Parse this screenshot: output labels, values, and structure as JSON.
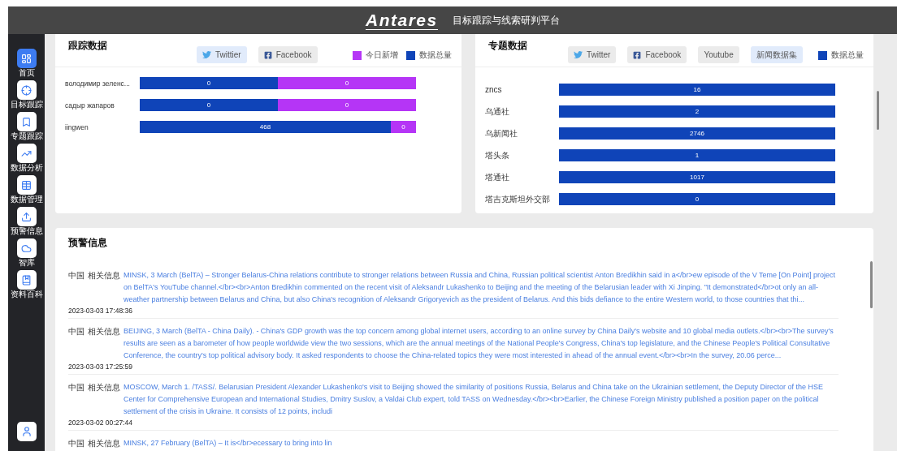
{
  "header": {
    "logo": "Antares",
    "title": "目标跟踪与线索研判平台"
  },
  "sidebar": {
    "items": [
      {
        "label": "首页",
        "selected": true
      },
      {
        "label": "目标跟踪",
        "selected": false
      },
      {
        "label": "专题跟踪",
        "selected": false
      },
      {
        "label": "数据分析",
        "selected": false
      },
      {
        "label": "数据管理",
        "selected": false
      },
      {
        "label": "预警信息",
        "selected": false
      },
      {
        "label": "智库",
        "selected": false
      },
      {
        "label": "资料百科",
        "selected": false
      }
    ]
  },
  "tracking": {
    "title": "跟踪数据",
    "tabs": [
      {
        "label": "Twittier",
        "selected": true
      },
      {
        "label": "Facebook",
        "selected": false
      }
    ],
    "legend": [
      {
        "label": "今日新增",
        "color": "#b535f6"
      },
      {
        "label": "数据总量",
        "color": "#0f44b8"
      }
    ],
    "rows": [
      {
        "name": "володимир зеленс...",
        "total": "0",
        "today": "0"
      },
      {
        "name": "садыр жапаров",
        "total": "0",
        "today": "0"
      },
      {
        "name": "iingwen",
        "total": "468",
        "today": "0"
      }
    ]
  },
  "topics": {
    "title": "专题数据",
    "tabs": [
      {
        "label": "Twitter",
        "selected": false
      },
      {
        "label": "Facebook",
        "selected": false
      },
      {
        "label": "Youtube",
        "selected": false
      },
      {
        "label": "新闻数据集",
        "selected": true
      }
    ],
    "legend": [
      {
        "label": "数据总量",
        "color": "#0f44b8"
      }
    ],
    "rows": [
      {
        "name": "zncs",
        "total": "16"
      },
      {
        "name": "乌通社",
        "total": "2"
      },
      {
        "name": "乌新闻社",
        "total": "2746"
      },
      {
        "name": "塔头条",
        "total": "1"
      },
      {
        "name": "塔通社",
        "total": "1017"
      },
      {
        "name": "塔吉克斯坦外交部",
        "total": "0"
      }
    ]
  },
  "alerts": {
    "title": "预警信息",
    "items": [
      {
        "country": "中国",
        "type": "相关信息",
        "text": "MINSK, 3 March (BelTA) – Stronger Belarus-China relations contribute to stronger relations between Russia and China, Russian political scientist Anton Bredikhin said in a</br>ew episode of the V Teme [On Point] project on BelTA's YouTube channel.</br><br>Anton Bredikhin commented on the recent visit of Aleksandr Lukashenko to Beijing and the meeting of the Belarusian leader with Xi Jinping. \"It demonstrated</br>ot only an all-weather partnership between Belarus and China, but also China's recognition of Aleksandr Grigoryevich as the president of Belarus. And this bids defiance to the entire Western world, to those countries that thi...",
        "time": "2023-03-03 17:48:36"
      },
      {
        "country": "中国",
        "type": "相关信息",
        "text": "BEIJING, 3 March (BelTA - China Daily). - China's GDP growth was the top concern among global internet users, according to an online survey by China Daily's website and 10 global media outlets.</br><br>The survey's results are seen as a barometer of how people worldwide view the two sessions, which are the annual meetings of the National People's Congress, China's top legislature, and the Chinese People's Political Consultative Conference, the country's top political advisory body. It asked respondents to choose the China-related topics they were most interested in ahead of the annual event.</br><br>In the survey, 20.06 perce...",
        "time": "2023-03-03 17:25:59"
      },
      {
        "country": "中国",
        "type": "相关信息",
        "text": "MOSCOW, March 1. /TASS/. Belarusian President Alexander Lukashenko's visit to Beijing showed the similarity of positions Russia, Belarus and China take on the Ukrainian settlement, the Deputy Director of the HSE Center for Comprehensive European and International Studies, Dmitry Suslov, a Valdai Club expert, told TASS on Wednesday.</br><br>Earlier, the Chinese Foreign Ministry published a position paper on the political settlement of the crisis in Ukraine. It consists of 12 points, includi",
        "time": "2023-03-02 00:27:44"
      },
      {
        "country": "中国",
        "type": "相关信息",
        "text": "MINSK, 27 February (BelTA) – It is</br>ecessary to bring into lin"
      }
    ]
  }
}
